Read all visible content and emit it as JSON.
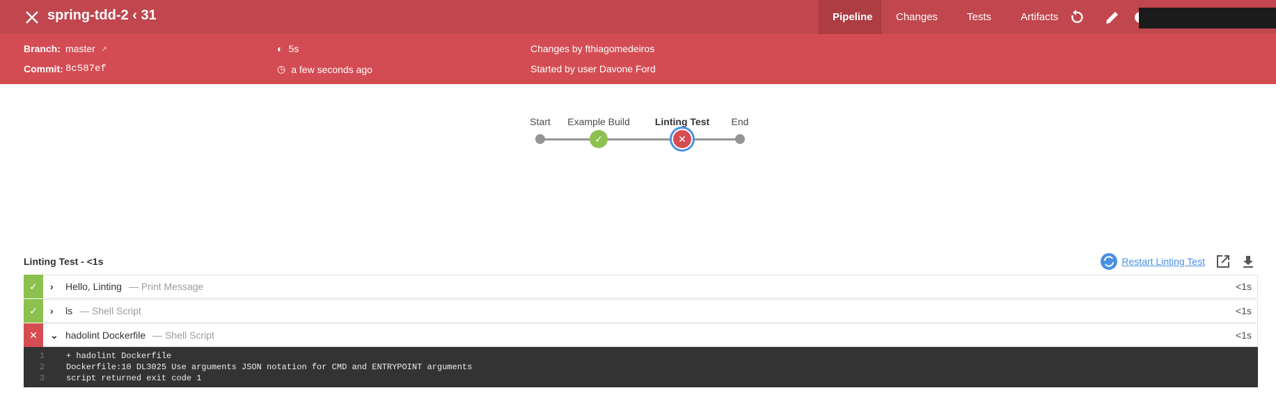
{
  "header": {
    "title": "spring-tdd-2",
    "run_number": "31",
    "tabs": [
      "Pipeline",
      "Changes",
      "Tests",
      "Artifacts"
    ],
    "active_tab": "Pipeline",
    "colors": {
      "failure": "#d54c53",
      "success": "#8cc04f",
      "accent": "#4a90e2"
    }
  },
  "info": {
    "branch_label": "Branch:",
    "branch": "master",
    "commit_label": "Commit:",
    "commit": "8c587ef",
    "duration": "5s",
    "started": "a few seconds ago",
    "changes": "Changes by fthiagomedeiros",
    "cause": "Started by user Davone Ford"
  },
  "pipeline": {
    "stages": [
      {
        "name": "Start",
        "status": "none"
      },
      {
        "name": "Example Build",
        "status": "success"
      },
      {
        "name": "Linting Test",
        "status": "failure",
        "selected": true
      },
      {
        "name": "End",
        "status": "none"
      }
    ]
  },
  "section": {
    "title": "Linting Test - <1s",
    "restart_label": "Restart Linting Test"
  },
  "steps": [
    {
      "name": "Hello, Linting",
      "desc": "— Print Message",
      "duration": "<1s",
      "status": "success",
      "expanded": false
    },
    {
      "name": "ls",
      "desc": "— Shell Script",
      "duration": "<1s",
      "status": "success",
      "expanded": false
    },
    {
      "name": "hadolint Dockerfile",
      "desc": "— Shell Script",
      "duration": "<1s",
      "status": "failure",
      "expanded": true
    }
  ],
  "log": [
    {
      "n": "1",
      "text": "+ hadolint Dockerfile"
    },
    {
      "n": "2",
      "text": "Dockerfile:10 DL3025 Use arguments JSON notation for CMD and ENTRYPOINT arguments"
    },
    {
      "n": "3",
      "text": "script returned exit code 1"
    }
  ]
}
